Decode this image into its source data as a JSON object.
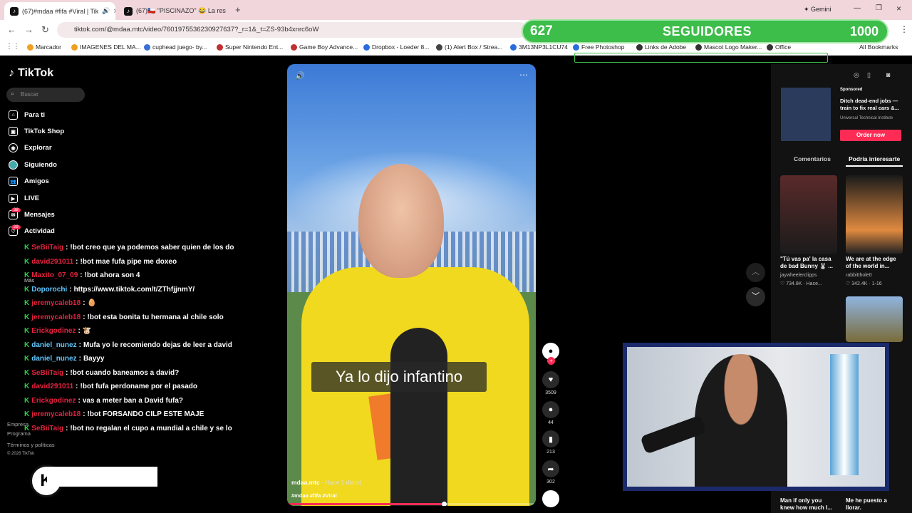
{
  "browser": {
    "tabs": [
      {
        "title": "(67)#mdaa #fifa #Viral | Tik",
        "active": true,
        "audio": true
      },
      {
        "title": "(67)🇨🇱 \"PISCINAZO\" 😂 La res",
        "active": false
      }
    ],
    "gemini_label": "Gemini",
    "url": "tiktok.com/@mdaa.mtc/video/7601975536230927637?_r=1&_t=ZS-93b4xnrc6oW",
    "bookmarks": [
      "Marcador",
      "IMAGENES DEL MA...",
      "cuphead juego- by...",
      "Super Nintendo Ent...",
      "Game Boy Advance...",
      "Dropbox - Loeder 8...",
      "(1) Alert Box / Strea...",
      "3M13NP3L1CU74",
      "Free Photoshop",
      "Links de Adobe",
      "Mascot Logo Maker...",
      "Office"
    ],
    "all_bookmarks": "All Bookmarks"
  },
  "overlay": {
    "followers": "627",
    "label": "SEGUIDORES",
    "goal": "1000"
  },
  "sidebar": {
    "logo": "TikTok",
    "search_placeholder": "Buscar",
    "items": [
      {
        "label": "Para ti"
      },
      {
        "label": "TikTok Shop"
      },
      {
        "label": "Explorar"
      },
      {
        "label": "Siguiendo"
      },
      {
        "label": "Amigos"
      },
      {
        "label": "LIVE"
      },
      {
        "label": "Mensajes",
        "badge": "38"
      },
      {
        "label": "Actividad",
        "badge": "29"
      }
    ],
    "more": "Más",
    "footer": [
      "Empresa",
      "Programa",
      "Términos y políticas",
      "© 2026 TikTok"
    ]
  },
  "chat": [
    {
      "user": "SeBiiTaig",
      "msg": "!bot creo que ya podemos saber quien de los do"
    },
    {
      "user": "david291011",
      "msg": "!bot mae fufa pipe me doxeo"
    },
    {
      "user": "Maxito_07_09",
      "msg": "!bot ahora son 4"
    },
    {
      "user": "Doporochi",
      "msg": "https://www.tiktok.com/t/ZThfjjnmY/",
      "color": "blue"
    },
    {
      "user": "jeremycaleb18",
      "msg": "🥚"
    },
    {
      "user": "jeremycaleb18",
      "msg": "!bot esta bonita tu hermana al chile solo"
    },
    {
      "user": "Erickgodinez",
      "msg": "🐮"
    },
    {
      "user": "daniel_nunez",
      "msg": "Mufa yo le recomiendo dejas de leer a david",
      "color": "blue"
    },
    {
      "user": "daniel_nunez",
      "msg": "Bayyy",
      "color": "blue"
    },
    {
      "user": "SeBiiTaig",
      "msg": "!bot cuando baneamos a david?"
    },
    {
      "user": "david291011",
      "msg": "!bot fufa perdoname por el pasado"
    },
    {
      "user": "Erickgodinez",
      "msg": "vas a meter ban a David fufa?"
    },
    {
      "user": "jeremycaleb18",
      "msg": "!bot FORSANDO CILP ESTE MAJE"
    },
    {
      "user": "SeBiiTaig",
      "msg": "!bot no regalan el cupo a mundial a chile y se lo"
    }
  ],
  "video": {
    "subtitle": "Ya lo dijo infantino",
    "username": "mdaa.mtc",
    "time": "· Hace 1 día(s)",
    "tags": "#mdaa #fifa #Viral",
    "progress": 0.63
  },
  "actions": {
    "likes": "3509",
    "comments": "44",
    "saves": "213",
    "shares": "302"
  },
  "right": {
    "sponsored": "Sponsored",
    "ad_title": "Ditch dead-end jobs — train to fix real cars &...",
    "ad_source": "Universal Technical Institute",
    "ad_cta": "Order now",
    "tab_comments": "Comentarios",
    "tab_interest": "Podría interesarte",
    "videos": [
      {
        "caption": "\"Tú vas pa' la casa de bad Bunny 🐰 ...",
        "user": "jaywheelerclipps",
        "meta": "♡ 734.8K · Hace..."
      },
      {
        "caption": "We are at the edge of the world in...",
        "user": "rabbitthole0",
        "meta": "♡ 342.4K · 1-16"
      },
      {
        "caption": "Man if only you knew how much I...",
        "user": "",
        "meta": ""
      },
      {
        "caption": "Me he puesto a llorar.",
        "user": "",
        "meta": ""
      }
    ]
  }
}
